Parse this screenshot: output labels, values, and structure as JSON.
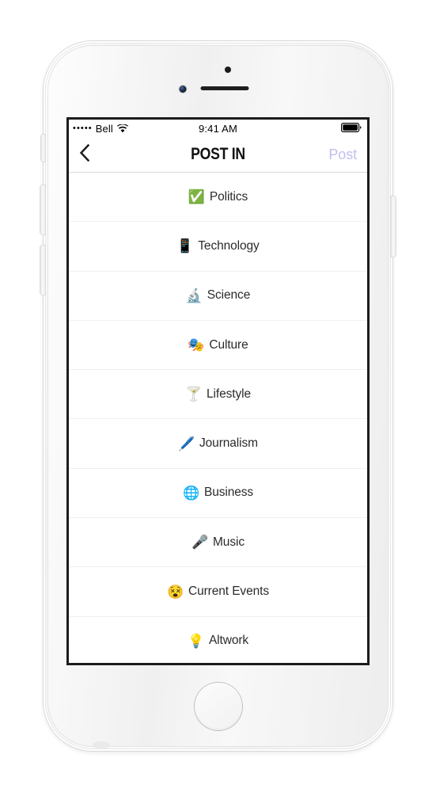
{
  "device": {
    "name": "white-smartphone",
    "camera_icon": "front-camera-icon",
    "speaker_icon": "earpiece-speaker-icon",
    "sensor_icon": "proximity-sensor-icon",
    "home_button_label": "Home",
    "buttons": {
      "silent": "Silent switch",
      "volume_up": "Volume up",
      "volume_down": "Volume down",
      "power": "Power"
    }
  },
  "status_bar": {
    "signal_dots": "•••••",
    "carrier": "Bell",
    "wifi_icon": "wifi-icon",
    "time": "9:41 AM",
    "battery_icon": "battery-full-icon"
  },
  "nav_bar": {
    "back_icon": "chevron-left-icon",
    "title": "POST IN",
    "post_label": "Post",
    "post_color": "#bfc0ee"
  },
  "categories": [
    {
      "emoji": "✅",
      "icon_name": "white-heavy-check-mark-icon",
      "label": "Politics"
    },
    {
      "emoji": "📱",
      "icon_name": "mobile-phone-icon",
      "label": "Technology"
    },
    {
      "emoji": "🔬",
      "icon_name": "microscope-icon",
      "label": "Science"
    },
    {
      "emoji": "🎭",
      "icon_name": "performing-arts-masks-icon",
      "label": "Culture"
    },
    {
      "emoji": "🍸",
      "icon_name": "cocktail-glass-icon",
      "label": "Lifestyle"
    },
    {
      "emoji": "🖊️",
      "icon_name": "pen-icon",
      "label": "Journalism"
    },
    {
      "emoji": "🌐",
      "icon_name": "globe-with-meridians-icon",
      "label": "Business"
    },
    {
      "emoji": "🎤",
      "icon_name": "microphone-icon",
      "label": "Music"
    },
    {
      "emoji": "😵",
      "icon_name": "dizzy-face-icon",
      "label": "Current Events"
    },
    {
      "emoji": "💡",
      "icon_name": "light-bulb-icon",
      "label": "Altwork"
    }
  ]
}
